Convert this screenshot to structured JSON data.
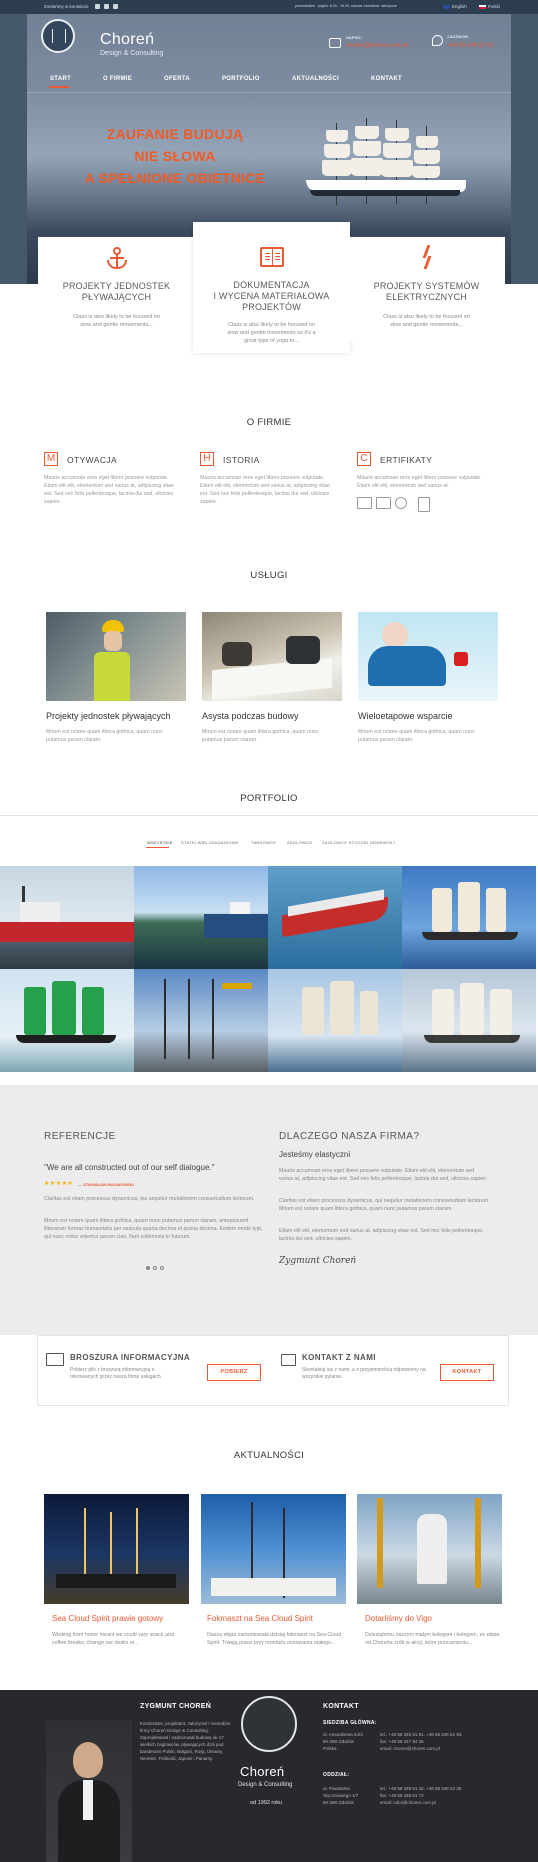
{
  "colors": {
    "accent": "#e85a34",
    "header_bg": "#2d3e51",
    "footer_bg": "#27292c"
  },
  "topbar": {
    "contact_label": "Zostańmy w kontakcie",
    "social": [
      "facebook-icon",
      "twitter-icon",
      "youtube-icon"
    ],
    "hours": "poniedziałek - piątek: 8.00 - 16.00, sobota i niedziela: nieczynne",
    "lang_en": "English",
    "lang_pl": "Polski"
  },
  "header": {
    "logo_text": "CHOREŃ DESIGN & CONSULTING",
    "brand_name": "Choreń",
    "brand_sub": "Design & Consulting",
    "write_label": "NAPISZ:",
    "write_value": "choren@choren.com.pl",
    "call_label": "ZADZWOŃ:",
    "call_value": "+48 58 345 61 91"
  },
  "nav": [
    "START",
    "O FIRMIE",
    "OFERTA",
    "PORTFOLIO",
    "AKTUALNOŚCI",
    "KONTAKT"
  ],
  "hero": {
    "lines": [
      "ZAUFANIE BUDUJĄ",
      "NIE SŁOWA",
      "A SPEŁNIONE OBIETNICE"
    ]
  },
  "services": [
    {
      "icon": "anchor-icon",
      "title": "PROJEKTY JEDNOSTEK\nPŁYWAJĄCYCH",
      "desc": "Class is also likely to be focused on slow and gentle movements..."
    },
    {
      "icon": "book-icon",
      "title": "DOKUMENTACJA\nI WYCENA MATERIAŁOWA\nPROJEKTÓW",
      "desc": "Class is also likely to be focused on slow and gentle movements so it's a great type of yoga to..."
    },
    {
      "icon": "lightning-icon",
      "title": "PROJEKTY SYSTEMÓW\nELEKTRYCZNYCH",
      "desc": "Class is also likely to be focused on slow and gentle movements..."
    }
  ],
  "firma": {
    "title": "O FIRMIE",
    "items": [
      {
        "letter": "M",
        "title": "OTYWACJA",
        "text": "Mauris accumsan eros eget libero posuere vulputate. Etiam elit elit, elementum sed varius at, adipiscing vitae est. Sed nec felis pellentesque, lacinia dui sed, ultricies sapien."
      },
      {
        "letter": "H",
        "title": "ISTORIA",
        "text": "Mauris accumsan eros eget libero posuere vulputate. Etiam elit elit, elementum sed varius at, adipiscing vitae est. Sed nec felis pellentesque, lacinia dui sed, ultricies sapien."
      },
      {
        "letter": "C",
        "title": "ERTIFIKATY",
        "text": "Mauris accumsan eros eget libero posuere vulputate. Etiam elit elit, elementum sed varius at."
      }
    ]
  },
  "uslugi": {
    "title": "USŁUGI",
    "items": [
      {
        "title": "Projekty jednostek pływających",
        "text": "Mirum est notare quam littera gothica, quam nunc putamus parum claram."
      },
      {
        "title": "Asysta podczas budowy",
        "text": "Mirum est notare quam littera gothica, quam nunc putamus parum claram."
      },
      {
        "title": "Wieloetapowe wsparcie",
        "text": "Mirum est notare quam littera gothica, quam nunc putamus parum claram."
      }
    ]
  },
  "portfolio": {
    "title": "PORTFOLIO",
    "tabs": [
      "WSZYSTKIE",
      "STATKI WIELOZADANIOWE",
      "TANKOWCE",
      "ŻAGLOWCE",
      "ŻAGLOWCE STOCZNI GDAŃSKIEJ"
    ]
  },
  "referencje": {
    "title": "REFERENCJE",
    "quote": "\"We are all constructed out of our self dialogue.\"",
    "stars": "★★★★★",
    "author": "— STANISŁAW MALINOWSKI",
    "p1": "Claritas est etiam processus dynamicus, qui sequitur mutationem consuetudium lectorum.",
    "p2": "Mirum est notare quam littera gothica, quam nunc putamus parum claram, anteposuerit litterarum formas humanitatis per seacula quarta decima et quinta decima. Eodem modo typi, qui nunc nobis videntur parum clari, fiant sollemnes in futurum."
  },
  "dlaczego": {
    "title": "DLACZEGO NASZA FIRMA?",
    "subtitle": "Jesteśmy elastyczni",
    "p1": "Mauris accumsan eros eget libero posuere vulputate. Etiam elit elit, elementum sed varius at, adipiscing vitae est. Sed nec felis pellentesque, lacinia dui sed, ultricies sapien.",
    "p2": "Claritas est etiam processus dynamicus, qui sequitur mutationem consuetudium lectorum. Mirum est notare quam littera gothica, quam nunc putamus parum claram.",
    "p3": "Etiam elit elit, elementum sed varius at, adipiscing vitae est. Sed nec felis pellentesque, lacinia dui sed, ultricies sapien.",
    "signature": "Zygmunt Choreń"
  },
  "broszura": {
    "title": "BROSZURA INFORMACYJNA",
    "text": "Pobierz plik z broszurą informacyjną o oferowanych przez naszą firmę usługach.",
    "button": "POBIERZ"
  },
  "kontakt_banner": {
    "title": "KONTAKT Z NAMI",
    "text": "Skontaktuj się z nami, a z przyjemnością odpowiemy na wszystkie pytania.",
    "button": "KONTAKT"
  },
  "aktualnosci": {
    "title": "AKTUALNOŚCI",
    "items": [
      {
        "title": "Sea Cloud Spirit prawie gotowy",
        "text": "Working from home meant we could vary snack and coffee breaks, change our desks or..."
      },
      {
        "title": "Fokmaszt na Sea Cloud Spirit",
        "text": "Nasza ekipa zamontowała dzisiaj fokmaszt na Sea Cloud Spirit. Trwają prace przy montażu osnowania stałego..."
      },
      {
        "title": "Dotarliśmy do Vigo",
        "text": "Dziesiątemu naszym małym kolegom i kolegom, ze ekipa od Choreńa zrób w akcji, które przecenionio..."
      }
    ]
  },
  "footer": {
    "person_name": "ZYGMUNT CHOREŃ",
    "person_text": "Konstruktor, projektant, założyciel i menedżer firmy Choreń Design & Consulting. Zaprojektował i nadzorował budowę ok 17 wielkich żaglowców, pływających dziś pod banderami Polski, Bułgarii, Rosji, Ukrainy, Niemiec, Finlandii, Japonii i Panamy.",
    "brand_name": "Choreń",
    "brand_sub": "Design & Consulting",
    "since": "od 1992 roku",
    "contact_title": "KONTAKT",
    "hq_title": "SIEDZIBA GŁÓWNA:",
    "hq_addr": "ul. Amundsena 54/4\n80-288 Gdańsk\nPolska",
    "hq_phones": "tel.: +48 58 345 61 91, +48 58 345 61 93\nfax: +48 58 347 94 36\nemail: choren@choren.com.pl",
    "branch_title": "ODDZIAŁ:",
    "branch_addr": "ul. Powstania\nStyczniowego 1/7\n80-288 Gdańsk",
    "branch_phones": "tel.: +48 58 348 51 32, +48 58 348 52 28\nfax: +48 58 348 51 72\nemail: cdc4@choren.com.pl"
  }
}
